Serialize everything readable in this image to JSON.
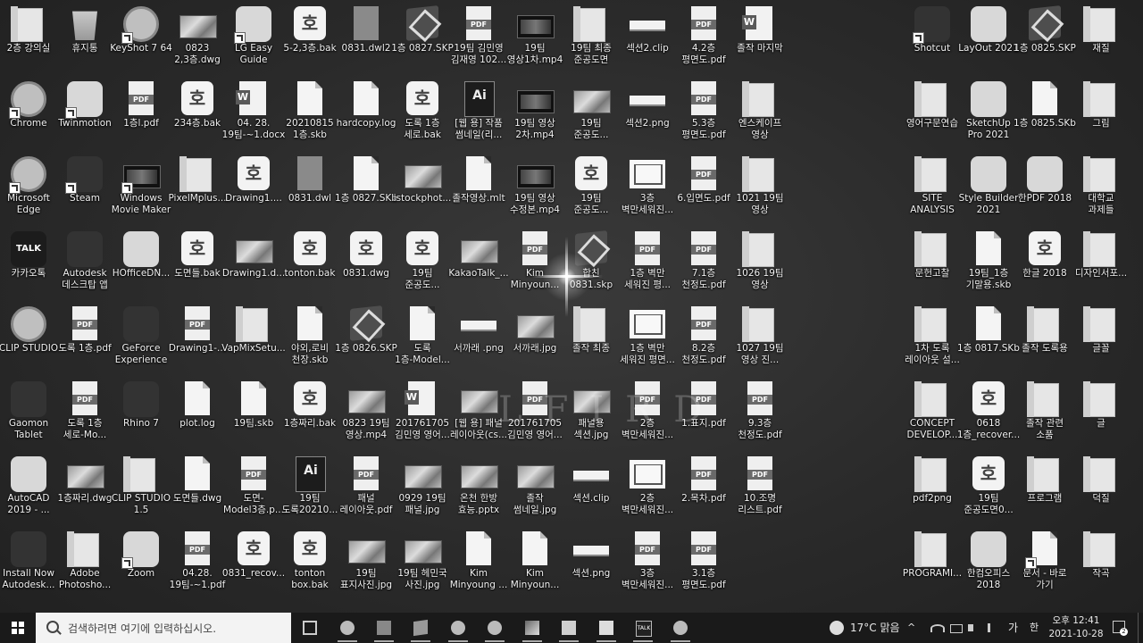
{
  "desktop": {
    "icons": [
      {
        "label": "2층 강의실",
        "kind": "folder",
        "col": 0,
        "row": 0
      },
      {
        "label": "휴지통",
        "kind": "recycle",
        "col": 1,
        "row": 0
      },
      {
        "label": "KeyShot 7 64",
        "kind": "app-circle",
        "col": 2,
        "row": 0,
        "shortcut": true
      },
      {
        "label": "0823\n2,3층.dwg",
        "kind": "img",
        "col": 3,
        "row": 0
      },
      {
        "label": "LG Easy\nGuide",
        "kind": "app",
        "col": 4,
        "row": 0,
        "shortcut": true
      },
      {
        "label": "5-2,3층.bak",
        "kind": "hwp",
        "col": 5,
        "row": 0
      },
      {
        "label": "0831.dwl2",
        "kind": "docgray",
        "col": 6,
        "row": 0
      },
      {
        "label": "1층 0827.SKP",
        "kind": "skp",
        "col": 7,
        "row": 0
      },
      {
        "label": "19팀 김민영\n김재영 102...",
        "kind": "pdf",
        "col": 8,
        "row": 0
      },
      {
        "label": "19팀\n영상1차.mp4",
        "kind": "film",
        "col": 9,
        "row": 0
      },
      {
        "label": "19팀 최종\n준공도면",
        "kind": "folder",
        "col": 10,
        "row": 0
      },
      {
        "label": "섹션2.clip",
        "kind": "thin",
        "col": 11,
        "row": 0
      },
      {
        "label": "4.2층\n평면도.pdf",
        "kind": "pdf",
        "col": 12,
        "row": 0
      },
      {
        "label": "졸작 마지막",
        "kind": "word",
        "col": 13,
        "row": 0
      },
      {
        "label": "Shotcut",
        "kind": "app-dark",
        "col": 16,
        "row": 0,
        "shortcut": true
      },
      {
        "label": "LayOut 2021",
        "kind": "app",
        "col": 17,
        "row": 0
      },
      {
        "label": "1층 0825.SKP",
        "kind": "skp",
        "col": 18,
        "row": 0
      },
      {
        "label": "재질",
        "kind": "folder",
        "col": 19,
        "row": 0
      },
      {
        "label": "Chrome",
        "kind": "app-circle",
        "col": 0,
        "row": 1,
        "shortcut": true
      },
      {
        "label": "Twinmotion",
        "kind": "app",
        "col": 1,
        "row": 1,
        "shortcut": true
      },
      {
        "label": "1층l.pdf",
        "kind": "pdf",
        "col": 2,
        "row": 1
      },
      {
        "label": "234층.bak",
        "kind": "hwp",
        "col": 3,
        "row": 1
      },
      {
        "label": "04. 28.\n19팀-~1.docx",
        "kind": "word",
        "col": 4,
        "row": 1
      },
      {
        "label": "20210815\n1층.skb",
        "kind": "doc",
        "col": 5,
        "row": 1
      },
      {
        "label": "hardcopy.log",
        "kind": "doc",
        "col": 6,
        "row": 1
      },
      {
        "label": "도록 1층\n세로.bak",
        "kind": "hwp",
        "col": 7,
        "row": 1
      },
      {
        "label": "[웹 용] 작품\n썸네일(리...",
        "kind": "ai",
        "col": 8,
        "row": 1
      },
      {
        "label": "19팀 영상\n2차.mp4",
        "kind": "film",
        "col": 9,
        "row": 1
      },
      {
        "label": "19팀\n준공도...",
        "kind": "img",
        "col": 10,
        "row": 1
      },
      {
        "label": "섹션2.png",
        "kind": "thin",
        "col": 11,
        "row": 1
      },
      {
        "label": "5.3층\n평면도.pdf",
        "kind": "pdf",
        "col": 12,
        "row": 1
      },
      {
        "label": "엔스케이프\n영상",
        "kind": "folder",
        "col": 13,
        "row": 1
      },
      {
        "label": "영어구문연습",
        "kind": "folder",
        "col": 16,
        "row": 1
      },
      {
        "label": "SketchUp\nPro 2021",
        "kind": "app",
        "col": 17,
        "row": 1
      },
      {
        "label": "1층 0825.SKb",
        "kind": "doc",
        "col": 18,
        "row": 1
      },
      {
        "label": "그림",
        "kind": "folder",
        "col": 19,
        "row": 1
      },
      {
        "label": "Microsoft\nEdge",
        "kind": "app-circle",
        "col": 0,
        "row": 2,
        "shortcut": true
      },
      {
        "label": "Steam",
        "kind": "app-dark",
        "col": 1,
        "row": 2,
        "shortcut": true
      },
      {
        "label": "Windows\nMovie Maker",
        "kind": "film",
        "col": 2,
        "row": 2,
        "shortcut": true
      },
      {
        "label": "PixelMplus...",
        "kind": "folder",
        "col": 3,
        "row": 2
      },
      {
        "label": "Drawing1....",
        "kind": "hwp",
        "col": 4,
        "row": 2
      },
      {
        "label": "0831.dwl",
        "kind": "docgray",
        "col": 5,
        "row": 2
      },
      {
        "label": "1층 0827.SKb",
        "kind": "doc",
        "col": 6,
        "row": 2
      },
      {
        "label": "istockphot...",
        "kind": "img",
        "col": 7,
        "row": 2
      },
      {
        "label": "졸작영상.mlt",
        "kind": "doc",
        "col": 8,
        "row": 2
      },
      {
        "label": "19팀 영상\n수정본.mp4",
        "kind": "film",
        "col": 9,
        "row": 2
      },
      {
        "label": "19팀\n준공도...",
        "kind": "hwp",
        "col": 10,
        "row": 2
      },
      {
        "label": "3층\n벽만세워진...",
        "kind": "plan",
        "col": 11,
        "row": 2
      },
      {
        "label": "6.입면도.pdf",
        "kind": "pdf",
        "col": 12,
        "row": 2
      },
      {
        "label": "1021 19팀\n영상",
        "kind": "folder",
        "col": 13,
        "row": 2
      },
      {
        "label": "SITE\nANALYSIS",
        "kind": "folder",
        "col": 16,
        "row": 2
      },
      {
        "label": "Style Builder\n2021",
        "kind": "app",
        "col": 17,
        "row": 2
      },
      {
        "label": "한PDF 2018",
        "kind": "app",
        "col": 18,
        "row": 2
      },
      {
        "label": "대학교\n과제들",
        "kind": "folder",
        "col": 19,
        "row": 2
      },
      {
        "label": "카카오톡",
        "kind": "talk",
        "col": 0,
        "row": 3
      },
      {
        "label": "Autodesk\n데스크탑 앱",
        "kind": "app-dark",
        "col": 1,
        "row": 3
      },
      {
        "label": "HOfficeDN...",
        "kind": "app",
        "col": 2,
        "row": 3
      },
      {
        "label": "도면들.bak",
        "kind": "hwp",
        "col": 3,
        "row": 3
      },
      {
        "label": "Drawing1.d...",
        "kind": "img",
        "col": 4,
        "row": 3
      },
      {
        "label": "tonton.bak",
        "kind": "hwp",
        "col": 5,
        "row": 3
      },
      {
        "label": "0831.dwg",
        "kind": "hwp",
        "col": 6,
        "row": 3
      },
      {
        "label": "19팀\n준공도...",
        "kind": "hwp",
        "col": 7,
        "row": 3
      },
      {
        "label": "KakaoTalk_...",
        "kind": "img",
        "col": 8,
        "row": 3
      },
      {
        "label": "Kim\nMinyoun...",
        "kind": "pdf",
        "col": 9,
        "row": 3
      },
      {
        "label": "합친\n0831.skp",
        "kind": "skp",
        "col": 10,
        "row": 3
      },
      {
        "label": "1층 벽만\n세워진 평...",
        "kind": "pdf",
        "col": 11,
        "row": 3
      },
      {
        "label": "7.1층\n천정도.pdf",
        "kind": "pdf",
        "col": 12,
        "row": 3
      },
      {
        "label": "1026 19팀\n영상",
        "kind": "folder",
        "col": 13,
        "row": 3
      },
      {
        "label": "문헌고찰",
        "kind": "folder",
        "col": 16,
        "row": 3
      },
      {
        "label": "19팀_1층\n기말용.skb",
        "kind": "doc",
        "col": 17,
        "row": 3
      },
      {
        "label": "한글 2018",
        "kind": "hwp",
        "col": 18,
        "row": 3
      },
      {
        "label": "디자인서포...",
        "kind": "folder",
        "col": 19,
        "row": 3
      },
      {
        "label": "CLIP STUDIO",
        "kind": "app-circle",
        "col": 0,
        "row": 4
      },
      {
        "label": "도록 1층.pdf",
        "kind": "pdf",
        "col": 1,
        "row": 4
      },
      {
        "label": "GeForce\nExperience",
        "kind": "app-dark",
        "col": 2,
        "row": 4
      },
      {
        "label": "Drawing1-...",
        "kind": "pdf",
        "col": 3,
        "row": 4
      },
      {
        "label": "VapMixSetu...",
        "kind": "folder",
        "col": 4,
        "row": 4
      },
      {
        "label": "야외,로비\n천장.skb",
        "kind": "doc",
        "col": 5,
        "row": 4
      },
      {
        "label": "1층 0826.SKP",
        "kind": "skp",
        "col": 6,
        "row": 4
      },
      {
        "label": "도록\n1층-Model...",
        "kind": "doc",
        "col": 7,
        "row": 4
      },
      {
        "label": "서까래 .png",
        "kind": "thin",
        "col": 8,
        "row": 4
      },
      {
        "label": "서까래.jpg",
        "kind": "img",
        "col": 9,
        "row": 4
      },
      {
        "label": "졸작 최종",
        "kind": "folder",
        "col": 10,
        "row": 4
      },
      {
        "label": "1층 벽만\n세워진 평면...",
        "kind": "plan",
        "col": 11,
        "row": 4
      },
      {
        "label": "8.2층\n천정도.pdf",
        "kind": "pdf",
        "col": 12,
        "row": 4
      },
      {
        "label": "1027 19팀\n영상 진...",
        "kind": "folder",
        "col": 13,
        "row": 4
      },
      {
        "label": "1차 도록\n레이아웃 설...",
        "kind": "folder",
        "col": 16,
        "row": 4
      },
      {
        "label": "1층 0817.SKb",
        "kind": "doc",
        "col": 17,
        "row": 4
      },
      {
        "label": "졸작 도록용",
        "kind": "folder",
        "col": 18,
        "row": 4
      },
      {
        "label": "글꼴",
        "kind": "folder",
        "col": 19,
        "row": 4
      },
      {
        "label": "Gaomon\nTablet",
        "kind": "app-dark",
        "col": 0,
        "row": 5
      },
      {
        "label": "도록 1층\n세로-Mo...",
        "kind": "pdf",
        "col": 1,
        "row": 5
      },
      {
        "label": "Rhino 7",
        "kind": "app-dark",
        "col": 2,
        "row": 5
      },
      {
        "label": "plot.log",
        "kind": "doc",
        "col": 3,
        "row": 5
      },
      {
        "label": "19팀.skb",
        "kind": "doc",
        "col": 4,
        "row": 5
      },
      {
        "label": "1층짜리.bak",
        "kind": "hwp",
        "col": 5,
        "row": 5
      },
      {
        "label": "0823 19팀\n영상.mp4",
        "kind": "img",
        "col": 6,
        "row": 5
      },
      {
        "label": "201761705\n김민영 영어...",
        "kind": "word",
        "col": 7,
        "row": 5
      },
      {
        "label": "[웹 용] 패널\n레이아웃(cs...",
        "kind": "img",
        "col": 8,
        "row": 5
      },
      {
        "label": "201761705\n김민영 영어...",
        "kind": "pdf",
        "col": 9,
        "row": 5
      },
      {
        "label": "패널용\n섹션.jpg",
        "kind": "img",
        "col": 10,
        "row": 5
      },
      {
        "label": "2층\n벽만세워진...",
        "kind": "pdf",
        "col": 11,
        "row": 5
      },
      {
        "label": "1.표지.pdf",
        "kind": "pdf",
        "col": 12,
        "row": 5
      },
      {
        "label": "9.3층\n천정도.pdf",
        "kind": "pdf",
        "col": 13,
        "row": 5
      },
      {
        "label": "CONCEPT\nDEVELOP...",
        "kind": "folder",
        "col": 16,
        "row": 5
      },
      {
        "label": "0618\n1층_recover...",
        "kind": "hwp",
        "col": 17,
        "row": 5
      },
      {
        "label": "졸작 관련\n소품",
        "kind": "folder",
        "col": 18,
        "row": 5
      },
      {
        "label": "글",
        "kind": "folder",
        "col": 19,
        "row": 5
      },
      {
        "label": "AutoCAD\n2019 - ...",
        "kind": "app",
        "col": 0,
        "row": 6
      },
      {
        "label": "1층짜리.dwg",
        "kind": "img",
        "col": 1,
        "row": 6
      },
      {
        "label": "CLIP STUDIO\n1.5",
        "kind": "folder",
        "col": 2,
        "row": 6
      },
      {
        "label": "도면들.dwg",
        "kind": "doc",
        "col": 3,
        "row": 6
      },
      {
        "label": "도면-\nModel3층.p...",
        "kind": "pdf",
        "col": 4,
        "row": 6
      },
      {
        "label": "19팀\n도록20210...",
        "kind": "ai",
        "col": 5,
        "row": 6
      },
      {
        "label": "패널\n레이아웃.pdf",
        "kind": "pdf",
        "col": 6,
        "row": 6
      },
      {
        "label": "0929 19팀\n패널.jpg",
        "kind": "img",
        "col": 7,
        "row": 6
      },
      {
        "label": "온천 한방\n효능.pptx",
        "kind": "img",
        "col": 8,
        "row": 6
      },
      {
        "label": "졸작\n썸네일.jpg",
        "kind": "img",
        "col": 9,
        "row": 6
      },
      {
        "label": "섹션.clip",
        "kind": "thin",
        "col": 10,
        "row": 6
      },
      {
        "label": "2층\n벽만세워진...",
        "kind": "plan",
        "col": 11,
        "row": 6
      },
      {
        "label": "2.목차.pdf",
        "kind": "pdf",
        "col": 12,
        "row": 6
      },
      {
        "label": "10.조명\n리스트.pdf",
        "kind": "pdf",
        "col": 13,
        "row": 6
      },
      {
        "label": "pdf2png",
        "kind": "folder",
        "col": 16,
        "row": 6
      },
      {
        "label": "19팀\n준공도면0...",
        "kind": "hwp",
        "col": 17,
        "row": 6
      },
      {
        "label": "프로그램",
        "kind": "folder",
        "col": 18,
        "row": 6
      },
      {
        "label": "덕질",
        "kind": "folder",
        "col": 19,
        "row": 6
      },
      {
        "label": "Install Now\nAutodesk...",
        "kind": "app-dark",
        "col": 0,
        "row": 7
      },
      {
        "label": "Adobe\nPhotosho...",
        "kind": "folder",
        "col": 1,
        "row": 7
      },
      {
        "label": "Zoom",
        "kind": "app",
        "col": 2,
        "row": 7,
        "shortcut": true
      },
      {
        "label": "04.28.\n19팀-~1.pdf",
        "kind": "pdf",
        "col": 3,
        "row": 7
      },
      {
        "label": "0831_recov...",
        "kind": "hwp",
        "col": 4,
        "row": 7
      },
      {
        "label": "tonton\nbox.bak",
        "kind": "hwp",
        "col": 5,
        "row": 7
      },
      {
        "label": "19팀\n표지사진.jpg",
        "kind": "img",
        "col": 6,
        "row": 7
      },
      {
        "label": "19팀 헤민국\n사진.jpg",
        "kind": "img",
        "col": 7,
        "row": 7
      },
      {
        "label": "Kim\nMinyoung ...",
        "kind": "doc",
        "col": 8,
        "row": 7
      },
      {
        "label": "Kim\nMinyoun...",
        "kind": "doc",
        "col": 9,
        "row": 7
      },
      {
        "label": "섹션.png",
        "kind": "thin",
        "col": 10,
        "row": 7
      },
      {
        "label": "3층\n벽만세워진...",
        "kind": "pdf",
        "col": 11,
        "row": 7
      },
      {
        "label": "3.1층\n평면도.pdf",
        "kind": "pdf",
        "col": 12,
        "row": 7
      },
      {
        "label": "PROGRAMI...",
        "kind": "folder",
        "col": 16,
        "row": 7
      },
      {
        "label": "한컴오피스\n2018",
        "kind": "app",
        "col": 17,
        "row": 7
      },
      {
        "label": "문서 - 바로\n가기",
        "kind": "doc",
        "col": 18,
        "row": 7,
        "shortcut": true
      },
      {
        "label": "작곡",
        "kind": "folder",
        "col": 19,
        "row": 7
      }
    ]
  },
  "watermark": "LFIRD",
  "taskbar": {
    "search_placeholder": "검색하려면 여기에 입력하십시오.",
    "pins": [
      {
        "name": "task-view-button",
        "glyph": "g-view"
      },
      {
        "name": "chrome-taskbar-button",
        "glyph": "g-circ"
      },
      {
        "name": "mail-taskbar-button",
        "glyph": "g-mail"
      },
      {
        "name": "sketchup-taskbar-button",
        "glyph": "g-skp"
      },
      {
        "name": "clip-studio-taskbar-button",
        "glyph": "g-circ"
      },
      {
        "name": "powerpoint-taskbar-button",
        "glyph": "g-circ"
      },
      {
        "name": "photos-taskbar-button",
        "glyph": "g-img"
      },
      {
        "name": "file-explorer-taskbar-button",
        "glyph": "g-fold"
      },
      {
        "name": "sticky-notes-taskbar-button",
        "glyph": "g-note"
      },
      {
        "name": "kakaotalk-taskbar-button",
        "glyph": "g-talk",
        "text": "TALK"
      },
      {
        "name": "edge-taskbar-button",
        "glyph": "g-circ"
      }
    ],
    "weather": "17°C 맑음",
    "ime": "가",
    "ime2": "한",
    "time": "오후 12:41",
    "date": "2021-10-28",
    "notifications": "2"
  }
}
